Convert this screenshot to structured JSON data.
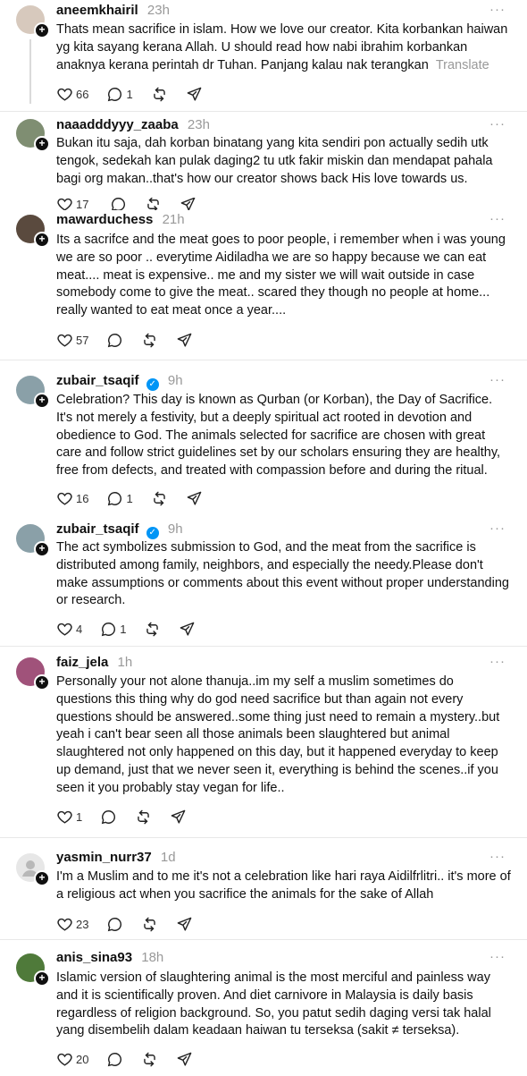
{
  "posts": [
    {
      "username": "aneemkhairil",
      "time": "23h",
      "verified": false,
      "body": "Thats mean sacrifice in islam. How we love our creator. Kita korbankan haiwan yg kita sayang kerana Allah. U should read how nabi ibrahim korbankan anaknya kerana perintah dr Tuhan. Panjang kalau nak terangkan",
      "translate": "Translate",
      "likes": "66",
      "replies": "1",
      "more": "···",
      "avatar_color": "#d7c9bd"
    },
    {
      "username": "naaadddyyy_zaaba",
      "time": "23h",
      "verified": false,
      "body": "Bukan itu saja, dah korban binatang yang kita sendiri pon actually sedih utk tengok, sedekah kan pulak daging2 tu utk fakir miskin dan mendapat pahala bagi org makan..that's how our creator shows back His love towards us.",
      "translate": "",
      "likes": "17",
      "replies": "",
      "more": "···",
      "avatar_color": "#7f8e72"
    },
    {
      "username": "mawarduchess",
      "time": "21h",
      "verified": false,
      "body": "Its a sacrifce and the meat goes to poor people, i remember when i was young we are so poor .. everytime Aidiladha we are so happy because we can eat meat.... meat is expensive.. me and my sister we will wait outside in case somebody come to give the meat.. scared they though no people at home... really wanted to eat meat once a year....",
      "translate": "",
      "likes": "57",
      "replies": "",
      "more": "···",
      "avatar_color": "#5a4a3e"
    },
    {
      "username": "zubair_tsaqif",
      "time": "9h",
      "verified": true,
      "body": "Celebration? This day is known as Qurban (or Korban), the Day of Sacrifice. It's not merely a festivity, but a deeply spiritual act rooted in devotion and obedience to God. The animals selected for sacrifice are chosen with great care and follow strict guidelines set by our scholars ensuring they are healthy, free from defects, and treated with compassion before and during the ritual.",
      "translate": "",
      "likes": "16",
      "replies": "1",
      "more": "···",
      "avatar_color": "#8aa0a8"
    },
    {
      "username": "zubair_tsaqif",
      "time": "9h",
      "verified": true,
      "body": "The act symbolizes submission to God, and the meat from the sacrifice is distributed among family, neighbors, and especially the needy.Please don't make assumptions or comments about this event without proper understanding or research.",
      "translate": "",
      "likes": "4",
      "replies": "1",
      "more": "···",
      "avatar_color": "#8aa0a8"
    },
    {
      "username": "faiz_jela",
      "time": "1h",
      "verified": false,
      "body": "Personally your not alone thanuja..im my self a muslim sometimes do questions this thing why do god need sacrifice but than again not every questions should be answered..some thing just need to remain a mystery..but yeah i can't bear seen all those animals been slaughtered but animal slaughtered not only happened on this day, but it happened everyday to keep up demand, just that we never seen it, everything is behind the scenes..if you seen it you probably stay vegan for life..",
      "translate": "",
      "likes": "1",
      "replies": "",
      "more": "···",
      "avatar_color": "#a0527a"
    },
    {
      "username": "yasmin_nurr37",
      "time": "1d",
      "verified": false,
      "body": "I'm a Muslim and to me it's not a celebration like hari raya Aidilfrlitri.. it's more of a religious act when you sacrifice the animals for the sake of Allah",
      "translate": "",
      "likes": "23",
      "replies": "",
      "more": "···",
      "avatar_color": "#e7e7e7"
    },
    {
      "username": "anis_sina93",
      "time": "18h",
      "verified": false,
      "body": "Islamic version of slaughtering animal is the most merciful and painless way and it is scientifically proven. And diet carnivore in Malaysia is daily basis regardless of religion background. So, you patut sedih daging versi tak halal yang disembelih dalam keadaan haiwan tu terseksa (sakit ≠ terseksa).",
      "translate": "",
      "likes": "20",
      "replies": "",
      "more": "···",
      "avatar_color": "#4f7a3a"
    }
  ]
}
